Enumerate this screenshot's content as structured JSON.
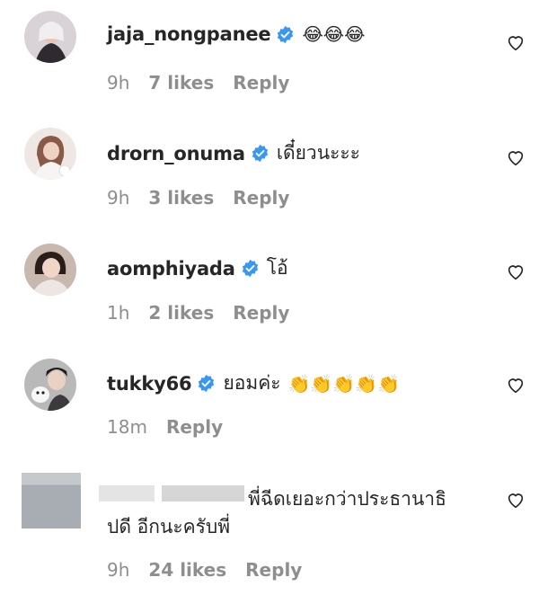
{
  "comments": [
    {
      "username": "jaja_nongpanee",
      "text": "",
      "emoji": "😂😂😂",
      "emoji_name": "laughing-tears-emoji",
      "time": "9h",
      "likes": "7 likes",
      "reply": "Reply"
    },
    {
      "username": "drorn_onuma",
      "text": "เดี๋ยวนะะะ",
      "emoji": "",
      "time": "9h",
      "likes": "3 likes",
      "reply": "Reply"
    },
    {
      "username": "aomphiyada",
      "text": "โอ้",
      "emoji": "",
      "time": "1h",
      "likes": "2 likes",
      "reply": "Reply"
    },
    {
      "username": "tukky66",
      "text": "ยอมค่ะ",
      "emoji": "👏👏👏👏👏",
      "emoji_name": "clapping-hands-emoji",
      "time": "18m",
      "likes": "",
      "reply": "Reply"
    },
    {
      "username": "",
      "text_line1": "พี่ฉีดเยอะกว่าประธานาธิ",
      "text_line2": "ปดี อีกนะครับพี่",
      "time": "9h",
      "likes": "24 likes",
      "reply": "Reply"
    }
  ],
  "icons": {
    "verified": "verified-badge-icon",
    "heart": "heart-outline-icon"
  },
  "colors": {
    "verified_blue": "#3897f0",
    "text": "#262626",
    "meta": "#8e8e8e"
  }
}
